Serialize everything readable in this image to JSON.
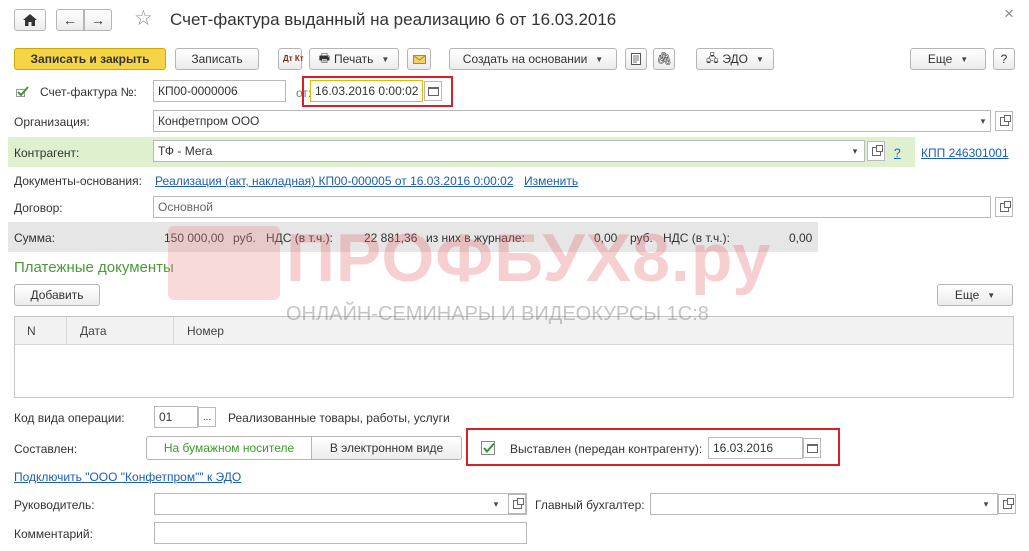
{
  "header": {
    "title": "Счет-фактура выданный на реализацию 6 от 16.03.2016",
    "close_glyph": "×"
  },
  "toolbar": {
    "save_close": "Записать и закрыть",
    "save": "Записать",
    "dtkt": "Дт Кт",
    "print": "Печать",
    "create_basis": "Создать на основании",
    "edo": "ЭДО",
    "more": "Еще",
    "help": "?"
  },
  "invoice": {
    "label": "Счет-фактура №:",
    "number": "КП00-0000006",
    "from_label": "от:",
    "date": "16.03.2016  0:00:02"
  },
  "organization": {
    "label": "Организация:",
    "value": "Конфетпром ООО"
  },
  "counterparty": {
    "label": "Контрагент:",
    "value": "ТФ - Мега",
    "help": "?",
    "kpp": "КПП 246301001"
  },
  "documents": {
    "label": "Документы-основания:",
    "link": "Реализация (акт, накладная) КП00-000005 от 16.03.2016 0:00:02",
    "change": "Изменить"
  },
  "contract": {
    "label": "Договор:",
    "value": "Основной"
  },
  "sum": {
    "label": "Сумма:",
    "amount": "150 000,00",
    "cur1": "руб.",
    "vat_label": "НДС (в т.ч.):",
    "vat": "22 881,36",
    "journal_label": "из них в журнале:",
    "journal": "0,00",
    "cur2": "руб.",
    "vat_label2": "НДС (в т.ч.):",
    "vat2": "0,00"
  },
  "payments": {
    "title": "Платежные документы",
    "add": "Добавить",
    "more": "Еще",
    "columns": [
      "N",
      "Дата",
      "Номер"
    ]
  },
  "operation": {
    "label": "Код вида операции:",
    "code": "01",
    "dots": "...",
    "desc": "Реализованные товары, работы, услуги"
  },
  "composed": {
    "label": "Составлен:",
    "paper": "На бумажном носителе",
    "electronic": "В электронном виде"
  },
  "issued": {
    "label": "Выставлен (передан контрагенту):",
    "date": "16.03.2016"
  },
  "edo_link": "Подключить \"ООО \"Конфетпром\"\" к ЭДО",
  "head": {
    "label": "Руководитель:",
    "accountant_label": "Главный бухгалтер:"
  },
  "comment": {
    "label": "Комментарий:"
  },
  "watermark": {
    "brand": "ПРОФБУХ8.ру",
    "tagline": "ОНЛАЙН-СЕМИНАРЫ И ВИДЕОКУРСЫ 1С:8"
  },
  "colors": {
    "accent_yellow": "#f5d547",
    "counterparty_green": "#dff0cf",
    "link_blue": "#1c5db8",
    "highlight_red": "#d7202a",
    "title_green": "#4b9a3a"
  }
}
